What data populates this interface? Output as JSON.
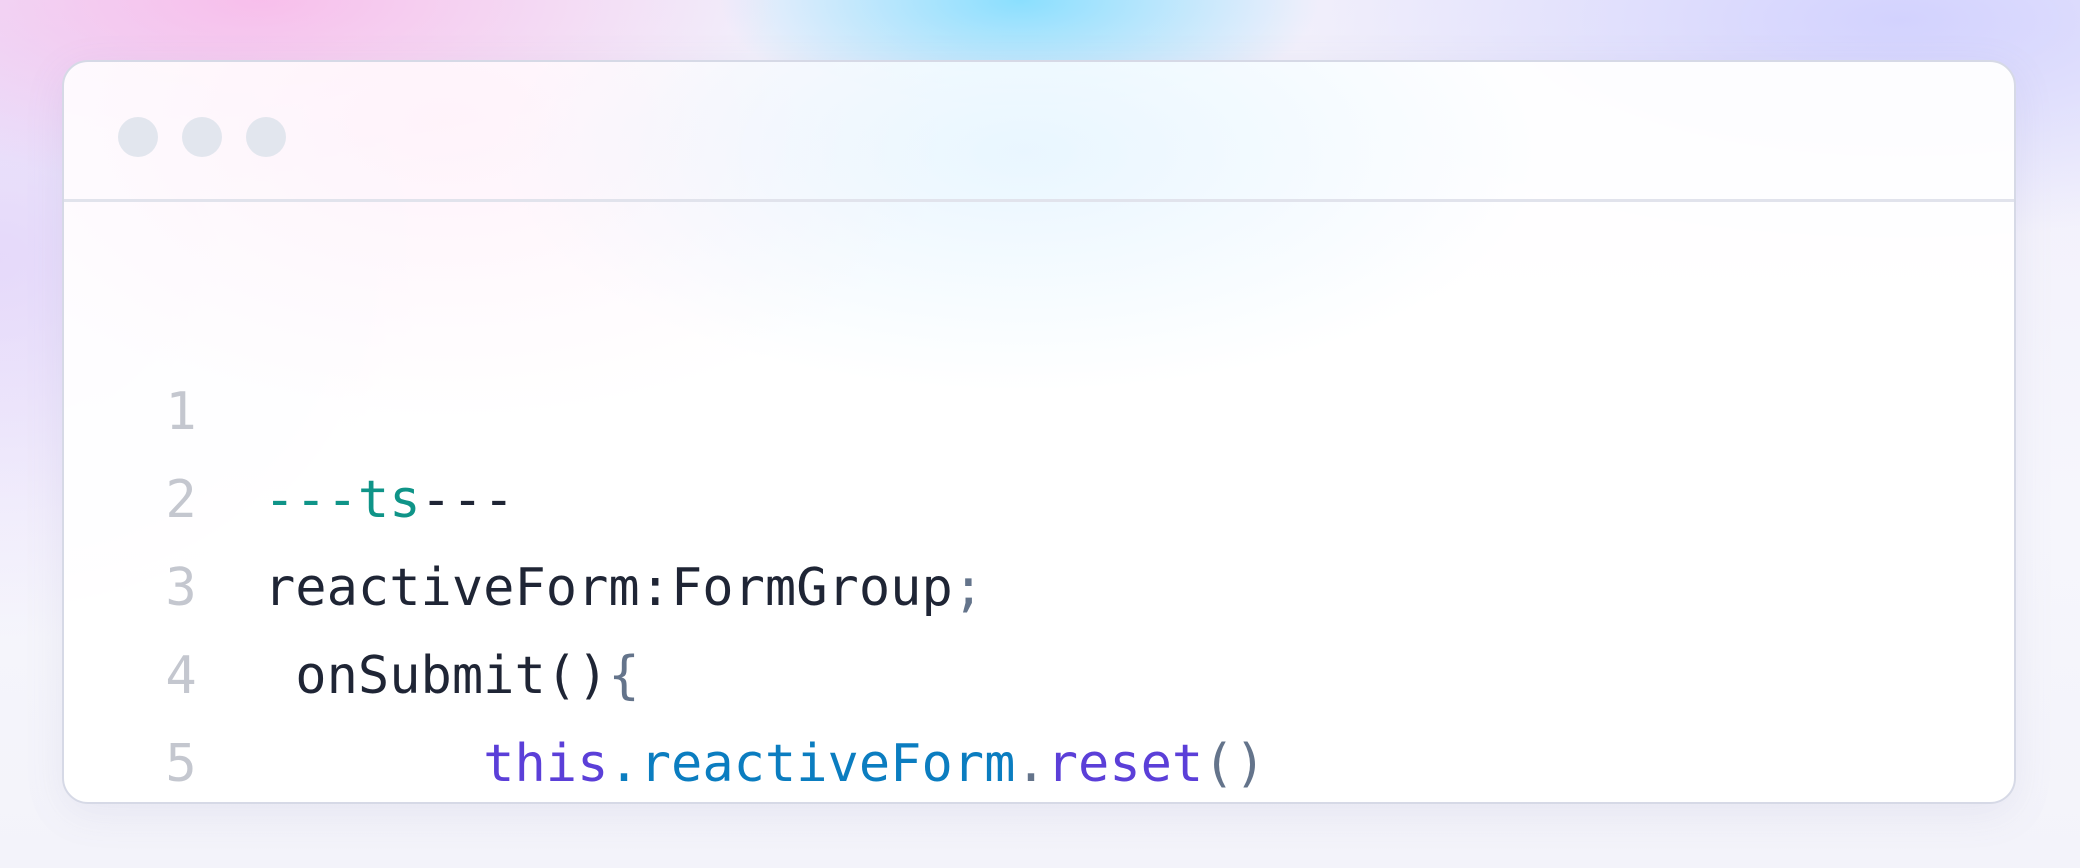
{
  "window": {
    "controls": [
      "close",
      "minimize",
      "maximize"
    ]
  },
  "code": {
    "lines": [
      {
        "number": "1",
        "tokens": [
          {
            "text": "---ts",
            "kind": "dash"
          },
          {
            "text": "---",
            "kind": "plain"
          }
        ]
      },
      {
        "number": "2",
        "tokens": [
          {
            "text": "reactiveForm:FormGroup",
            "kind": "plain"
          },
          {
            "text": ";",
            "kind": "punct"
          }
        ]
      },
      {
        "number": "3",
        "tokens": [
          {
            "text": " onSubmit()",
            "kind": "plain"
          },
          {
            "text": "{",
            "kind": "punct"
          }
        ]
      },
      {
        "number": "4",
        "tokens": [
          {
            "text": "       ",
            "kind": "plain"
          },
          {
            "text": "this",
            "kind": "kw"
          },
          {
            "text": ".",
            "kind": "prop"
          },
          {
            "text": "reactiveForm",
            "kind": "prop"
          },
          {
            "text": ".",
            "kind": "punct"
          },
          {
            "text": "reset",
            "kind": "kw"
          },
          {
            "text": "()",
            "kind": "punct"
          }
        ]
      },
      {
        "number": "5",
        "tokens": [
          {
            "text": "}",
            "kind": "punct"
          }
        ]
      }
    ]
  },
  "colors": {
    "dash": "#0f9488",
    "plain": "#1f2535",
    "punct": "#64748b",
    "keyword": "#5b3fd8",
    "property": "#0b7dc0",
    "line_number": "#c4c7cf",
    "window_dot": "#e2e6ee"
  }
}
